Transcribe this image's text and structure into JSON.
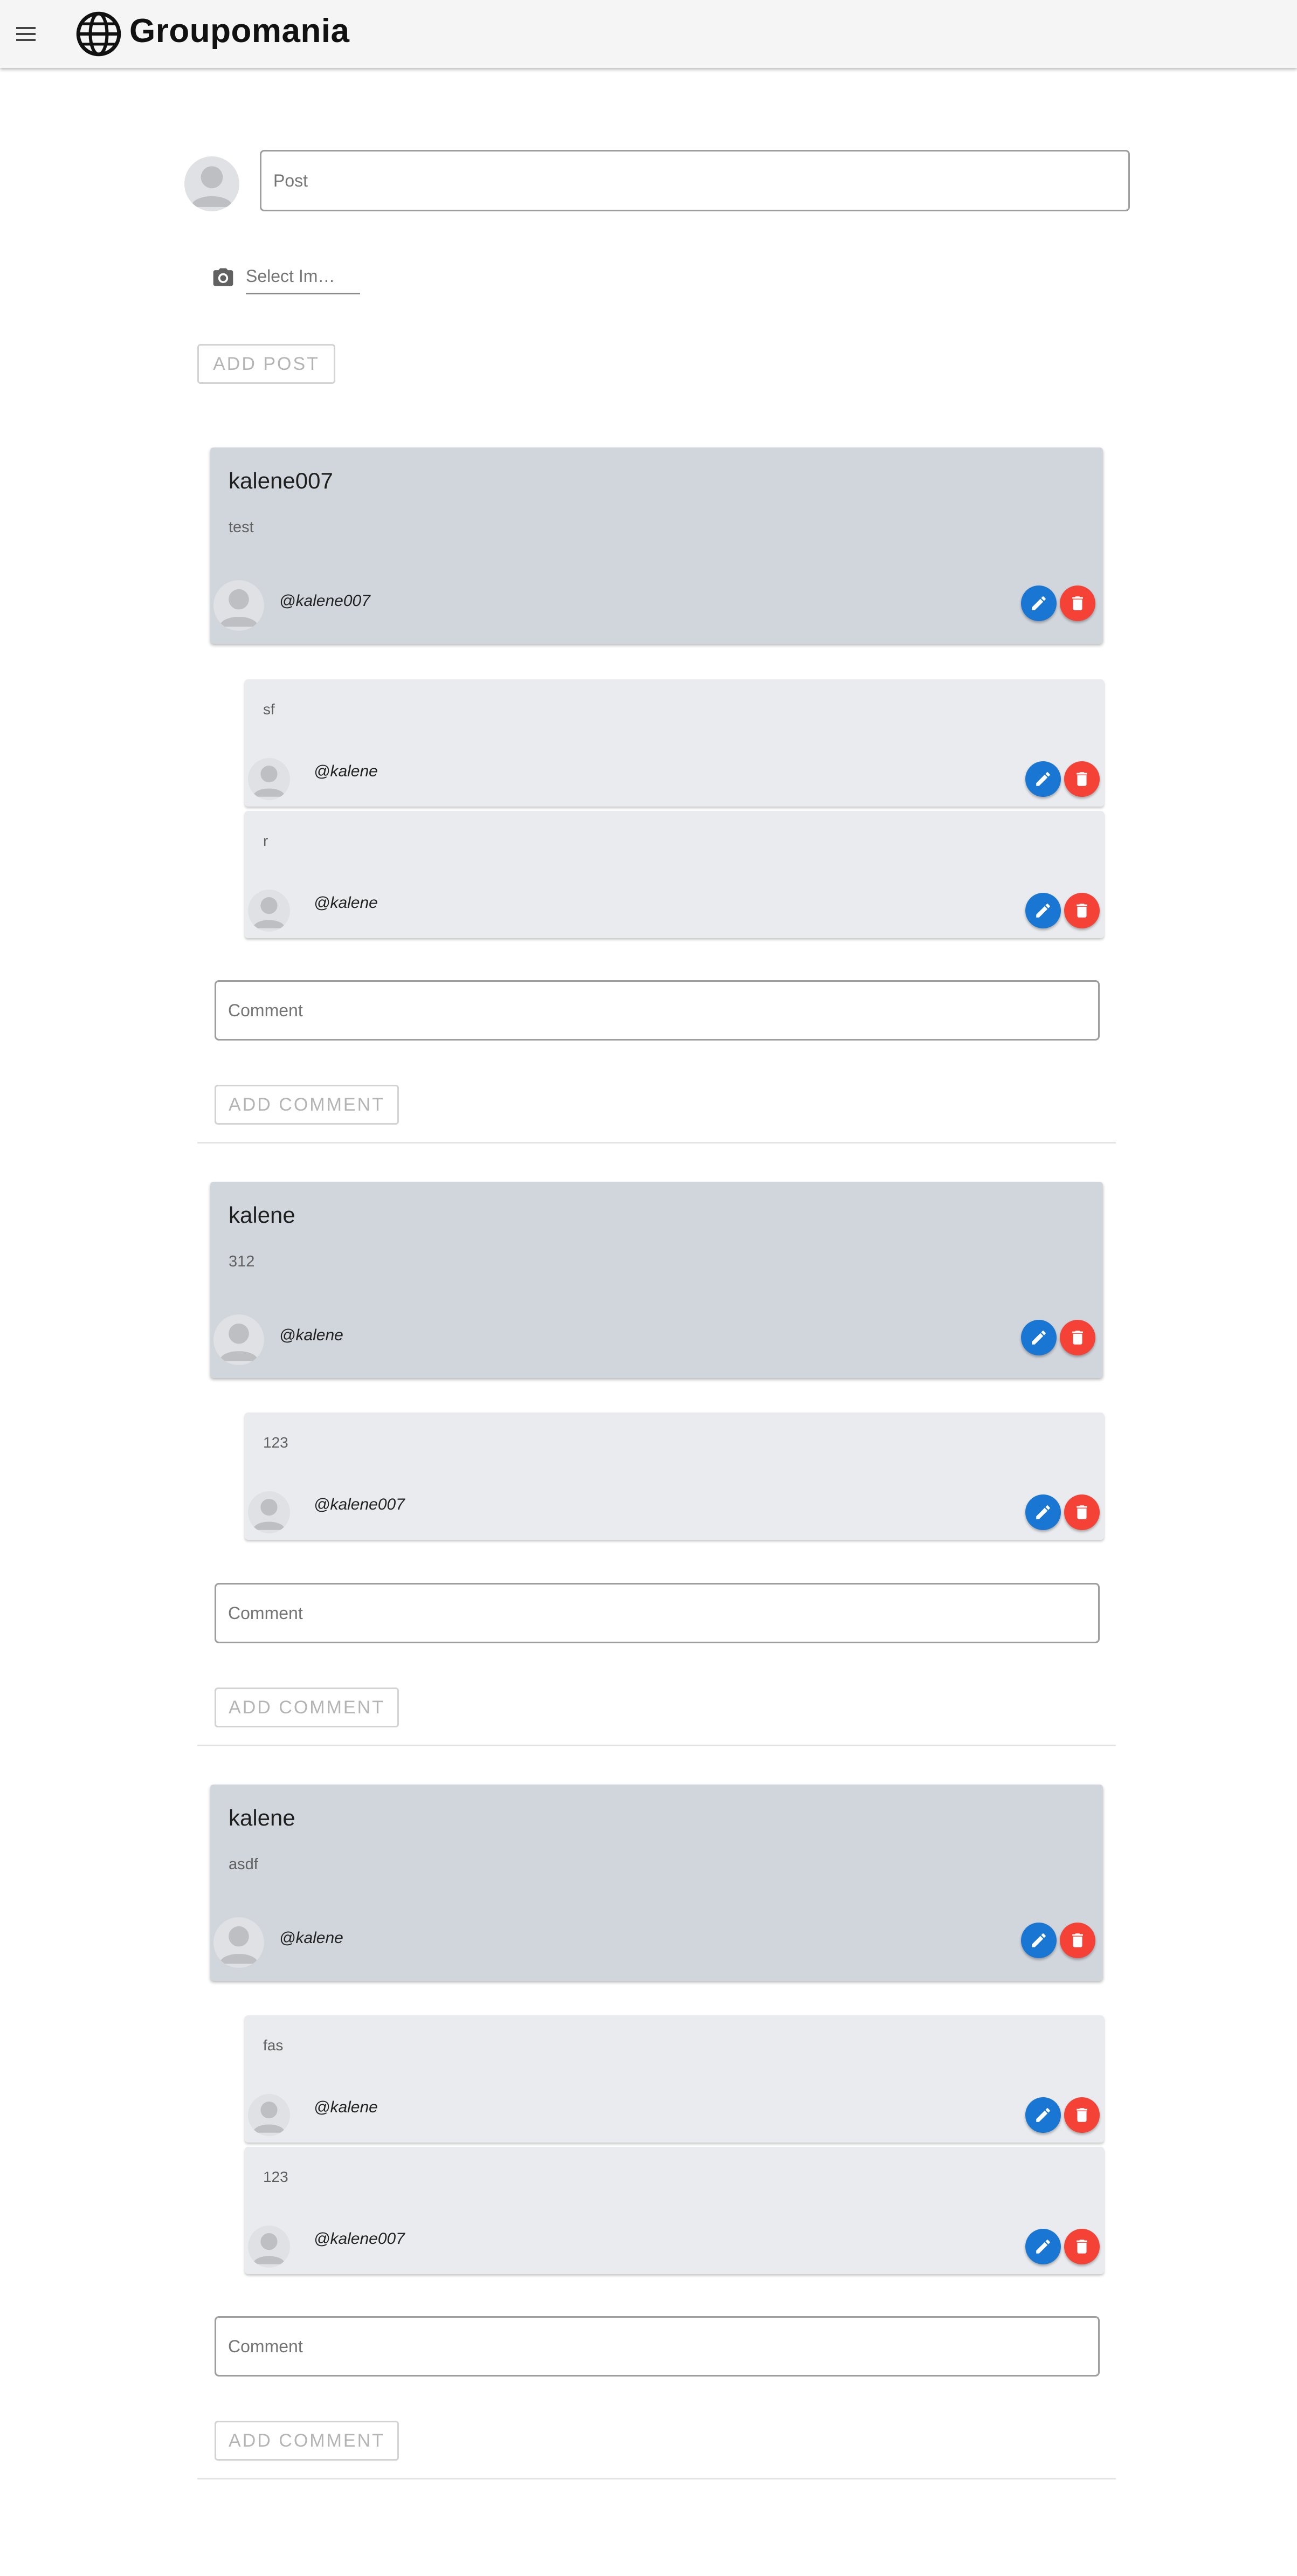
{
  "app": {
    "title": "Groupomania"
  },
  "composer": {
    "post_placeholder": "Post",
    "select_image_label": "Select Im…",
    "add_post_label": "ADD POST"
  },
  "posts": [
    {
      "title": "kalene007",
      "body": "test",
      "author": "@kalene007",
      "comments": [
        {
          "body": "sf",
          "author": "@kalene"
        },
        {
          "body": "r",
          "author": "@kalene"
        }
      ],
      "comment_placeholder": "Comment",
      "add_comment_label": "ADD COMMENT"
    },
    {
      "title": "kalene",
      "body": "312",
      "author": "@kalene",
      "comments": [
        {
          "body": "123",
          "author": "@kalene007"
        }
      ],
      "comment_placeholder": "Comment",
      "add_comment_label": "ADD COMMENT"
    },
    {
      "title": "kalene",
      "body": "asdf",
      "author": "@kalene",
      "comments": [
        {
          "body": "fas",
          "author": "@kalene"
        },
        {
          "body": "123",
          "author": "@kalene007"
        }
      ],
      "comment_placeholder": "Comment",
      "add_comment_label": "ADD COMMENT"
    }
  ],
  "icons": {
    "menu": "menu-icon",
    "logo": "globe-icon",
    "camera": "camera-icon",
    "edit": "pencil-icon",
    "delete": "trash-icon",
    "avatar": "person-icon"
  },
  "colors": {
    "edit": "#1976d2",
    "delete": "#f44336",
    "post_card": "#d1d6dc",
    "comment_card": "#e9ebee"
  }
}
